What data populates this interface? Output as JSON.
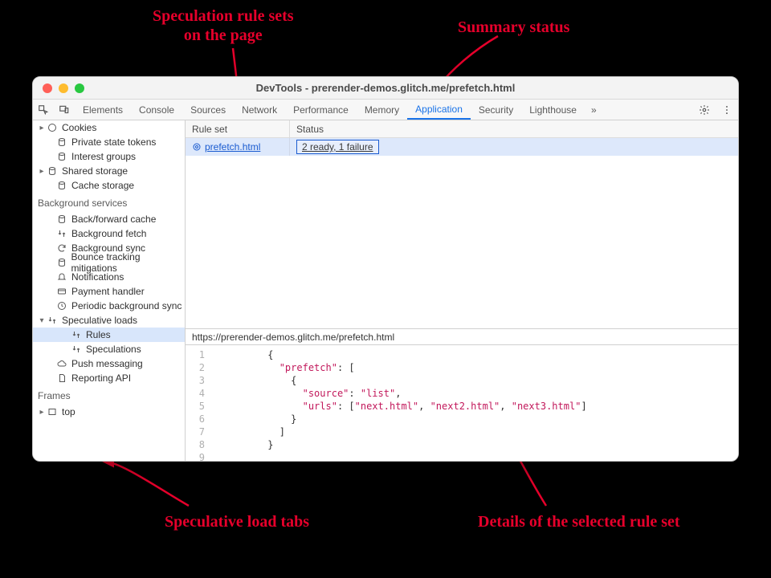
{
  "annotations": {
    "rule_sets": "Speculation rule sets\non the page",
    "summary_status": "Summary status",
    "speculative_tabs": "Speculative load tabs",
    "details": "Details of the selected rule set"
  },
  "window": {
    "title": "DevTools - prerender-demos.glitch.me/prefetch.html"
  },
  "panel_tabs": {
    "elements": "Elements",
    "console": "Console",
    "sources": "Sources",
    "network": "Network",
    "performance": "Performance",
    "memory": "Memory",
    "application": "Application",
    "security": "Security",
    "lighthouse": "Lighthouse",
    "more": "»"
  },
  "sidebar": {
    "cookies": "Cookies",
    "private_state_tokens": "Private state tokens",
    "interest_groups": "Interest groups",
    "shared_storage": "Shared storage",
    "cache_storage": "Cache storage",
    "bg_services": "Background services",
    "back_forward_cache": "Back/forward cache",
    "background_fetch": "Background fetch",
    "background_sync": "Background sync",
    "bounce_tracking": "Bounce tracking mitigations",
    "notifications": "Notifications",
    "payment_handler": "Payment handler",
    "periodic_sync": "Periodic background sync",
    "speculative_loads": "Speculative loads",
    "rules": "Rules",
    "speculations": "Speculations",
    "push_messaging": "Push messaging",
    "reporting_api": "Reporting API",
    "frames": "Frames",
    "top": "top"
  },
  "ruleset_table": {
    "col_ruleset": "Rule set",
    "col_status": "Status",
    "row0_name": " prefetch.html",
    "row0_status": "2 ready, 1 failure"
  },
  "detail": {
    "url": "https://prerender-demos.glitch.me/prefetch.html"
  },
  "code": {
    "k_prefetch": "\"prefetch\"",
    "k_source": "\"source\"",
    "v_source": "\"list\"",
    "k_urls": "\"urls\"",
    "v_url1": "\"next.html\"",
    "v_url2": "\"next2.html\"",
    "v_url3": "\"next3.html\"",
    "lines": "1\n2\n3\n4\n5\n6\n7\n8\n9"
  }
}
